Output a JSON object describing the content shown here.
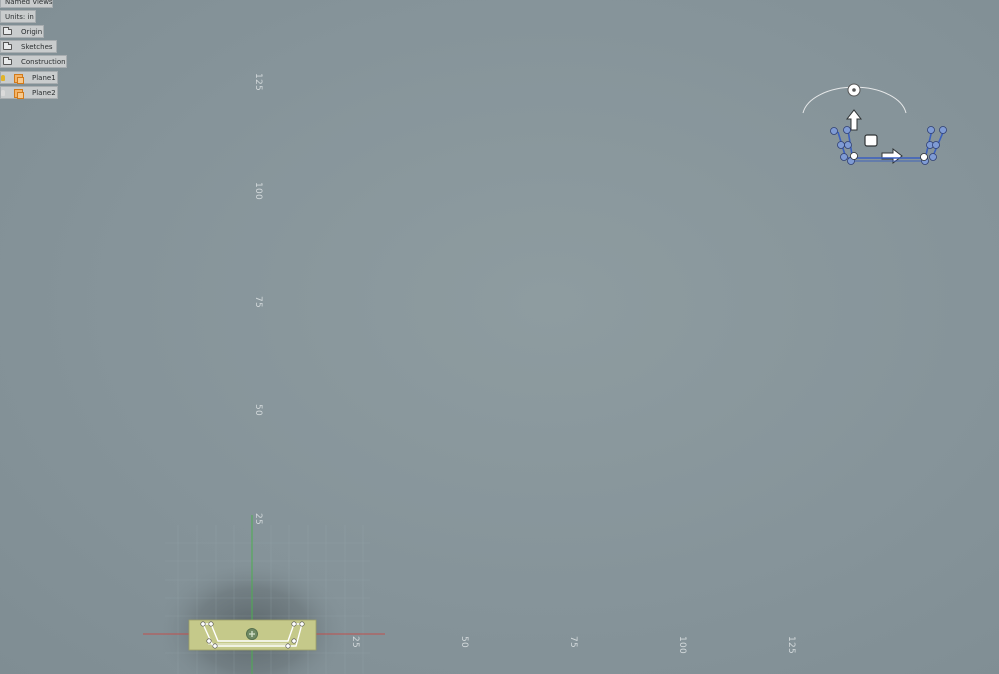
{
  "browser": {
    "named_views": "Named Views",
    "units": "Units: in",
    "items": [
      {
        "label": "Origin",
        "icon": "folder-icon"
      },
      {
        "label": "Sketches",
        "icon": "folder-icon"
      },
      {
        "label": "Construction",
        "icon": "folder-icon"
      },
      {
        "label": "Plane1",
        "icon": "construction-plane-icon",
        "visible": true
      },
      {
        "label": "Plane2",
        "icon": "construction-plane-icon",
        "visible": false
      }
    ]
  },
  "axis": {
    "vertical_ticks": [
      "125",
      "100",
      "75",
      "50",
      "25"
    ],
    "horizontal_ticks": [
      "25",
      "50",
      "75",
      "100",
      "125"
    ]
  },
  "colors": {
    "background": "#86949a",
    "sketch_fill": "#c5c98a",
    "x_axis": "#c0504d",
    "y_axis": "#4caf50",
    "manipulator": "#3a5fbf"
  }
}
